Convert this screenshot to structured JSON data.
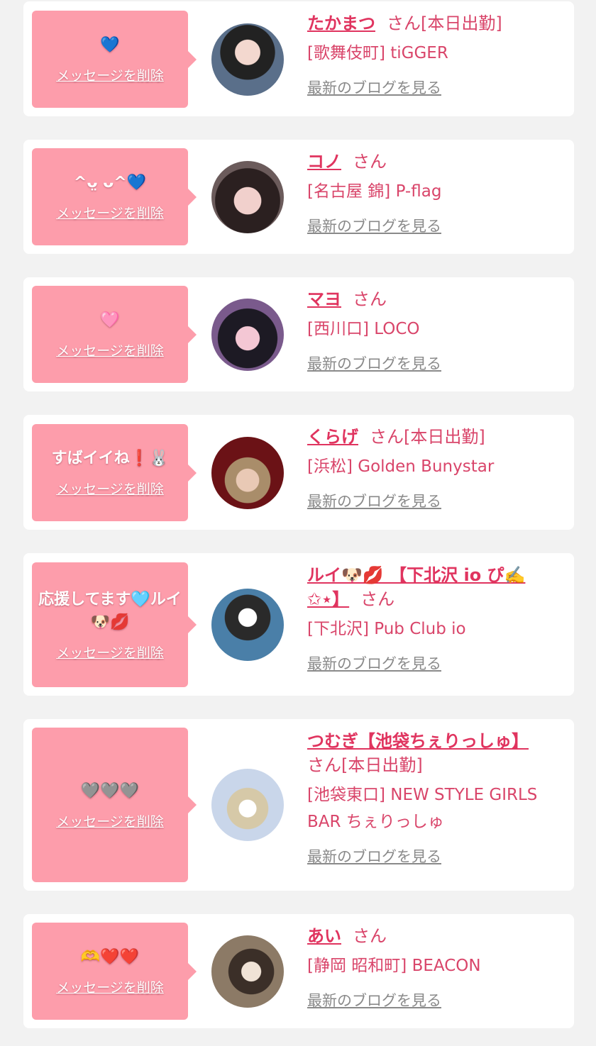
{
  "delete_label": "メッセージを削除",
  "blog_label": "最新のブログを見る",
  "san_label": "さん",
  "colors": {
    "bubble": "#fd9dab",
    "name": "#e0345f",
    "text": "#d9456a",
    "link": "#8a8a8a",
    "background": "#f2f2f2"
  },
  "items": [
    {
      "message": "💙",
      "name": "たかまつ",
      "status": "[本日出勤]",
      "shop": "[歌舞伎町] tiGGER"
    },
    {
      "message": "^ᴗ̤ ᴗ^💙",
      "name": "コノ",
      "status": "",
      "shop": "[名古屋 錦] P-flag"
    },
    {
      "message": "🩷",
      "name": "マヨ",
      "status": "",
      "shop": "[西川口] LOCO"
    },
    {
      "message": "すばイイね❗️🐰﻿﻿",
      "name": "くらげ",
      "status": "[本日出勤]",
      "shop": "[浜松] Golden Bunystar"
    },
    {
      "message": "応援してます🩵ルイ🐶💋",
      "name": "ルイ🐶💋 【下北沢 io ぴ✍️ ✩⋆】",
      "status": "",
      "shop": "[下北沢] Pub Club io"
    },
    {
      "message": "🩶🩶🩶",
      "name": "つむぎ【池袋ちぇりっしゅ】",
      "status": "[本日出勤]",
      "shop": "[池袋東口] NEW STYLE GIRLS BAR ちぇりっしゅ"
    },
    {
      "message": "🫶❤️❤️",
      "name": "あい",
      "status": "",
      "shop": "[静岡 昭和町] BEACON"
    }
  ]
}
